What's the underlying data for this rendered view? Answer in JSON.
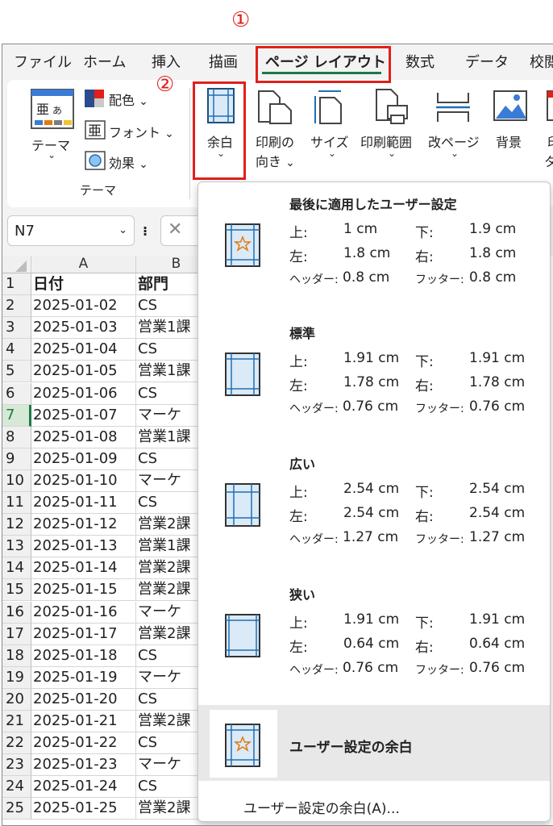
{
  "annotations": {
    "step1": "①",
    "step2": "②"
  },
  "tabs": [
    "ファイル",
    "ホーム",
    "挿入",
    "描画",
    "ページ レイアウト",
    "数式",
    "データ",
    "校閲"
  ],
  "ribbon": {
    "theme_label": "テーマ",
    "theme_chevron": "⌄",
    "colors": "配色",
    "fonts": "フォント",
    "effects": "効果",
    "group_label": "テーマ",
    "margins": "余白",
    "orientation_line1": "印刷の",
    "orientation_line2": "向き",
    "size": "サイズ",
    "print_area": "印刷範囲",
    "breaks": "改ページ",
    "background": "背景",
    "print_titles_line1": "印",
    "print_titles_line2": "タ"
  },
  "namebox": {
    "value": "N7",
    "dots": "⁝",
    "cancel": "✕"
  },
  "sheet": {
    "columns": [
      "A",
      "B"
    ],
    "header_row": [
      "日付",
      "部門"
    ],
    "rows": [
      [
        "2025-01-02",
        "CS"
      ],
      [
        "2025-01-03",
        "営業1課"
      ],
      [
        "2025-01-04",
        "CS"
      ],
      [
        "2025-01-05",
        "営業1課"
      ],
      [
        "2025-01-06",
        "CS"
      ],
      [
        "2025-01-07",
        "マーケ"
      ],
      [
        "2025-01-08",
        "営業1課"
      ],
      [
        "2025-01-09",
        "CS"
      ],
      [
        "2025-01-10",
        "マーケ"
      ],
      [
        "2025-01-11",
        "CS"
      ],
      [
        "2025-01-12",
        "営業2課"
      ],
      [
        "2025-01-13",
        "営業1課"
      ],
      [
        "2025-01-14",
        "営業2課"
      ],
      [
        "2025-01-15",
        "営業2課"
      ],
      [
        "2025-01-16",
        "マーケ"
      ],
      [
        "2025-01-17",
        "営業2課"
      ],
      [
        "2025-01-18",
        "CS"
      ],
      [
        "2025-01-19",
        "マーケ"
      ],
      [
        "2025-01-20",
        "CS"
      ],
      [
        "2025-01-21",
        "営業2課"
      ],
      [
        "2025-01-22",
        "CS"
      ],
      [
        "2025-01-23",
        "マーケ"
      ],
      [
        "2025-01-24",
        "CS"
      ],
      [
        "2025-01-25",
        "営業2課"
      ]
    ]
  },
  "margins_menu": {
    "presets": [
      {
        "title": "最後に適用したユーザー設定",
        "top_label": "上:",
        "top": "1 cm",
        "bottom_label": "下:",
        "bottom": "1.9 cm",
        "left_label": "左:",
        "left": "1.8 cm",
        "right_label": "右:",
        "right": "1.8 cm",
        "header_label": "ヘッダー:",
        "header": "0.8 cm",
        "footer_label": "フッター:",
        "footer": "0.8 cm"
      },
      {
        "title": "標準",
        "top_label": "上:",
        "top": "1.91 cm",
        "bottom_label": "下:",
        "bottom": "1.91 cm",
        "left_label": "左:",
        "left": "1.78 cm",
        "right_label": "右:",
        "right": "1.78 cm",
        "header_label": "ヘッダー:",
        "header": "0.76 cm",
        "footer_label": "フッター:",
        "footer": "0.76 cm"
      },
      {
        "title": "広い",
        "top_label": "上:",
        "top": "2.54 cm",
        "bottom_label": "下:",
        "bottom": "2.54 cm",
        "left_label": "左:",
        "left": "2.54 cm",
        "right_label": "右:",
        "right": "2.54 cm",
        "header_label": "ヘッダー:",
        "header": "1.27 cm",
        "footer_label": "フッター:",
        "footer": "1.27 cm"
      },
      {
        "title": "狭い",
        "top_label": "上:",
        "top": "1.91 cm",
        "bottom_label": "下:",
        "bottom": "1.91 cm",
        "left_label": "左:",
        "left": "0.64 cm",
        "right_label": "右:",
        "right": "0.64 cm",
        "header_label": "ヘッダー:",
        "header": "0.76 cm",
        "footer_label": "フッター:",
        "footer": "0.76 cm"
      }
    ],
    "custom_margins_item": "ユーザー設定の余白",
    "custom_margins_link": "ユーザー設定の余白(A)..."
  },
  "colors": {
    "accent_red": "#e0201b",
    "excel_green": "#1d7a45",
    "icon_blue": "#1f6fb5",
    "star_orange": "#e07a10"
  }
}
